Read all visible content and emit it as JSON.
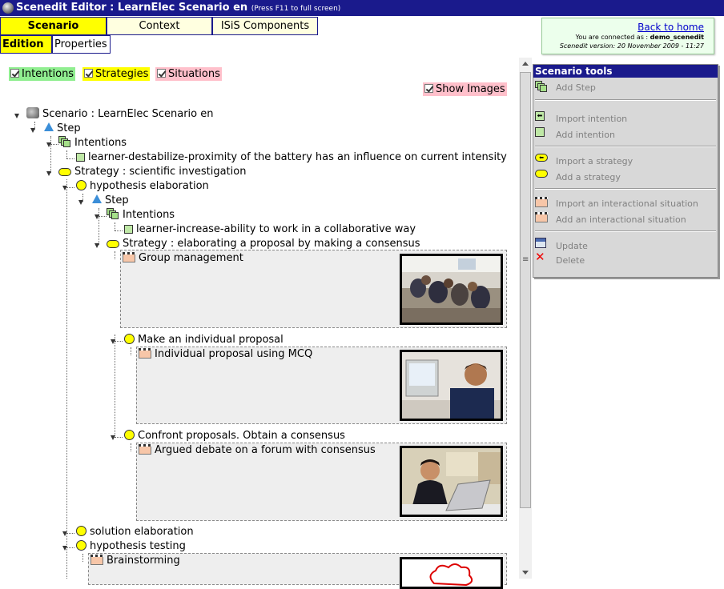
{
  "window": {
    "title": "Scenedit Editor : LearnElec Scenario en",
    "title_note": "(Press F11 to full screen)"
  },
  "tabs": {
    "scenario": "Scenario",
    "context": "Context",
    "isis": "ISiS Components",
    "edition": "Edition",
    "properties": "Properties"
  },
  "connection": {
    "back_home": "Back to home",
    "connected_prefix": "You are connected as : ",
    "user": "demo_scenedit",
    "version": "Scenedit version: 20 November 2009 - 11:27"
  },
  "filters": {
    "intentions": "Intentions",
    "strategies": "Strategies",
    "situations": "Situations",
    "show_images": "Show Images"
  },
  "tree": {
    "scenario": "Scenario : LearnElec Scenario en",
    "step1": "Step",
    "intentions1": "Intentions",
    "intent1": "learner-destabilize-proximity of the battery has an influence on current intensity",
    "strategy1": "Strategy : scientific investigation",
    "hypothesis_elab": "hypothesis elaboration",
    "step2": "Step",
    "intentions2": "Intentions",
    "intent2": "learner-increase-ability to work in a collaborative way",
    "strategy2": "Strategy : elaborating a proposal by making a consensus",
    "sit_group": "Group management",
    "individual": "Make an individual proposal",
    "sit_mcq": "Individual proposal using MCQ",
    "confront": "Confront proposals. Obtain a consensus",
    "sit_debate": "Argued debate on a forum with consensus",
    "solution": "solution elaboration",
    "hyp_testing": "hypothesis testing",
    "sit_brainstorm": "Brainstorming"
  },
  "tools": {
    "title": "Scenario tools",
    "add_step": "Add Step",
    "import_intention": "Import intention",
    "add_intention": "Add intention",
    "import_strategy": "Import a strategy",
    "add_strategy": "Add a strategy",
    "import_situation": "Import an interactional situation",
    "add_situation": "Add an interactional situation",
    "update": "Update",
    "delete": "Delete"
  },
  "colors": {
    "titlebar": "#1a1a8c",
    "intentions_bg": "#90ee90",
    "strategies_bg": "#ffff00",
    "situations_bg": "#ffc0cb",
    "tab_active": "#ffff00",
    "tab_inactive": "#ffffe0"
  }
}
